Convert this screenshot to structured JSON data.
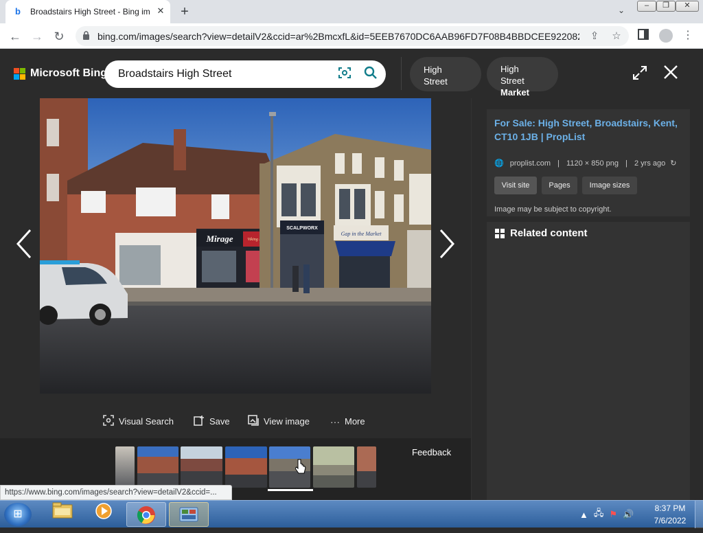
{
  "browser": {
    "tab_title": "Broadstairs High Street - Bing im",
    "tab_close": "✕",
    "new_tab": "+",
    "url": "bing.com/images/search?view=detailV2&ccid=ar%2BmcxfL&id=5EEB7670DC6AAB96FD7F08B4BBDCEE9220820...",
    "status_url": "https://www.bing.com/images/search?view=detailV2&ccid=..."
  },
  "bing": {
    "brand": "Microsoft Bing",
    "query": "Broadstairs High Street",
    "related_searches": [
      {
        "line1": "High Street",
        "line2": ""
      },
      {
        "line1": "High Street",
        "line2": "Market"
      }
    ]
  },
  "viewer": {
    "actions": [
      {
        "icon": "visual-search-icon",
        "label": "Visual Search"
      },
      {
        "icon": "save-icon",
        "label": "Save"
      },
      {
        "icon": "view-image-icon",
        "label": "View image"
      },
      {
        "icon": "more-icon",
        "label": "More"
      }
    ],
    "feedback": "Feedback",
    "shop_signs": [
      "Mirage",
      "Viking Bay Emporium",
      "SCALPWORX",
      "Gap in the Market"
    ]
  },
  "source": {
    "title": "For Sale: High Street, Broadstairs, Kent, CT10 1JB | PropList",
    "site": "proplist.com",
    "dimensions": "1120 × 850 png",
    "age": "2 yrs ago",
    "buttons": [
      "Visit site",
      "Pages",
      "Image sizes"
    ],
    "copyright": "Image may be subject to copyright."
  },
  "related": {
    "title": "Related content"
  },
  "taskbar": {
    "time": "8:37 PM",
    "date": "7/6/2022"
  },
  "colors": {
    "link": "#6cb1e8",
    "accent": "#107c8a",
    "panel": "#2b2b2b",
    "card": "#333333"
  }
}
